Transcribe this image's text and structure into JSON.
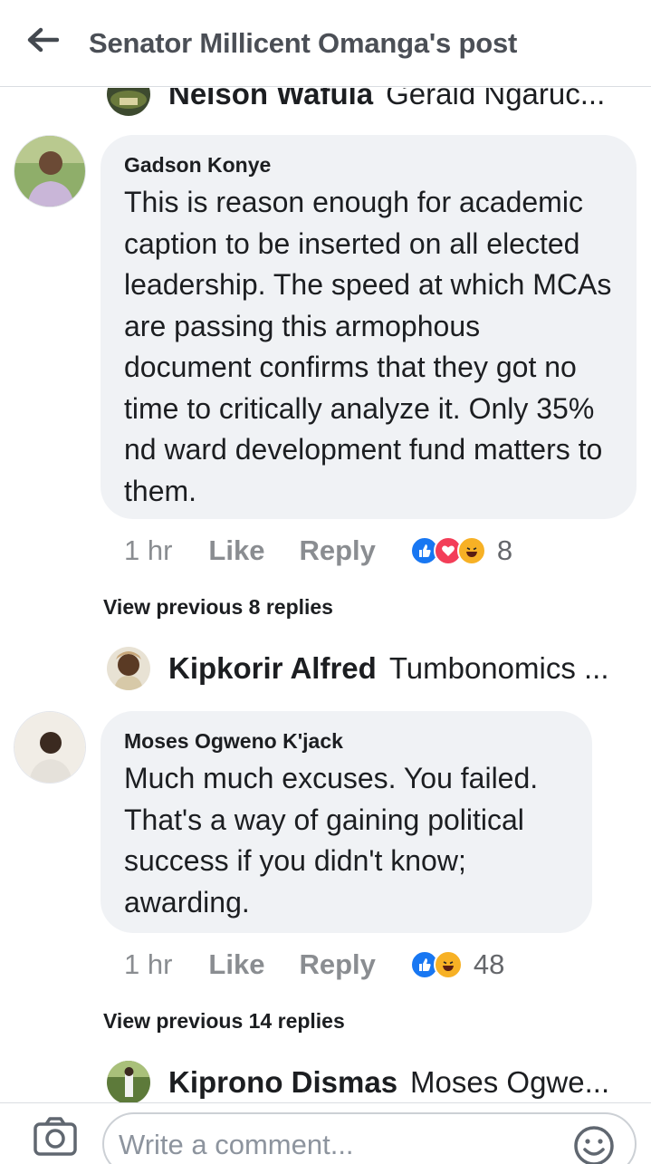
{
  "header": {
    "title": "Senator Millicent Omanga's post"
  },
  "top_reply_preview": {
    "name": "Nelson Wafula",
    "text": "Gerald Ngaruc..."
  },
  "comments": [
    {
      "author": "Gadson Konye",
      "text": "This is reason enough for academic caption to be inserted on all elected leadership. The speed at which MCAs are passing this armophous document confirms that they got no time to critically analyze it. Only 35% nd ward development fund matters to them.",
      "time": "1 hr",
      "like_label": "Like",
      "reply_label": "Reply",
      "reactions": [
        "like",
        "love",
        "haha"
      ],
      "reaction_count": "8",
      "view_previous": "View previous 8 replies",
      "reply_preview": {
        "name": "Kipkorir Alfred",
        "text": "Tumbonomics ..."
      }
    },
    {
      "author": "Moses Ogweno K'jack",
      "text": "Much much excuses. You failed. That's a way of gaining political success if you didn't know; awarding.",
      "time": "1 hr",
      "like_label": "Like",
      "reply_label": "Reply",
      "reactions": [
        "like",
        "haha"
      ],
      "reaction_count": "48",
      "view_previous": "View previous 14 replies",
      "reply_preview": {
        "name": "Kiprono Dismas",
        "text": "Moses Ogwe..."
      }
    }
  ],
  "composer": {
    "placeholder": "Write a comment..."
  },
  "colors": {
    "bubble": "#f0f2f5",
    "like_blue": "#1877f2",
    "love_red": "#f33e58",
    "haha_yellow": "#f7b125",
    "muted_text": "#8a8d91"
  }
}
